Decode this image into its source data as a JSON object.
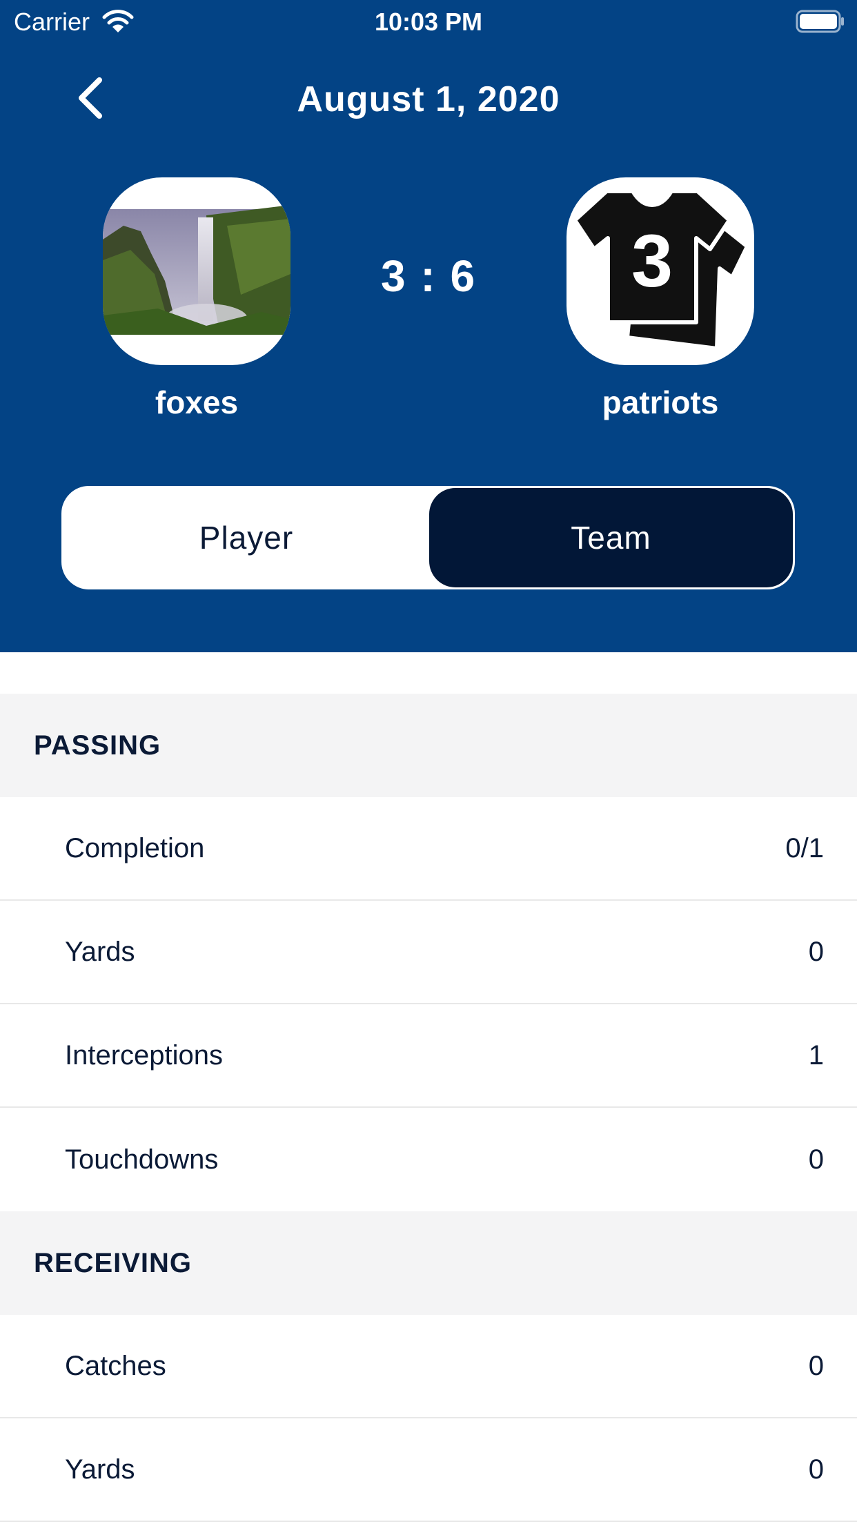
{
  "status_bar": {
    "carrier": "Carrier",
    "time": "10:03 PM"
  },
  "nav": {
    "title": "August 1, 2020",
    "back_icon": "chevron-left-icon"
  },
  "match": {
    "home_team": {
      "name": "foxes",
      "logo": "waterfall-photo"
    },
    "away_team": {
      "name": "patriots",
      "logo": "jersey-3-icon",
      "jersey_number": "3"
    },
    "score": "3 : 6"
  },
  "segmented_control": {
    "options": [
      "Player",
      "Team"
    ],
    "selected": "Team"
  },
  "sections": [
    {
      "title": "PASSING",
      "rows": [
        {
          "label": "Completion",
          "value": "0/1"
        },
        {
          "label": "Yards",
          "value": "0"
        },
        {
          "label": "Interceptions",
          "value": "1"
        },
        {
          "label": "Touchdowns",
          "value": "0"
        }
      ]
    },
    {
      "title": "RECEIVING",
      "rows": [
        {
          "label": "Catches",
          "value": "0"
        },
        {
          "label": "Yards",
          "value": "0"
        }
      ]
    }
  ],
  "colors": {
    "header_bg": "#034385",
    "selected_segment": "#021737",
    "section_bg": "#f4f4f5",
    "text_dark": "#0b1a36"
  }
}
